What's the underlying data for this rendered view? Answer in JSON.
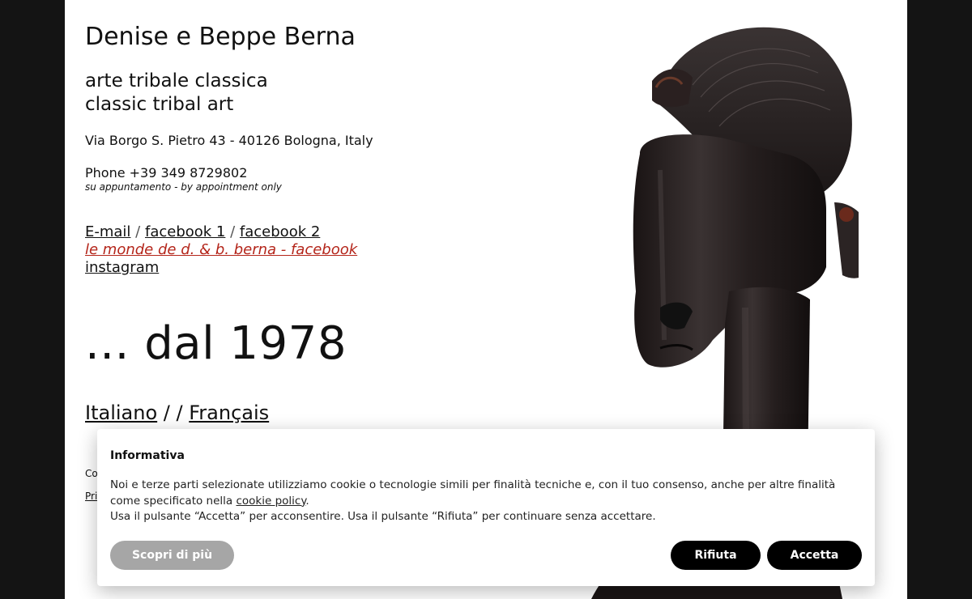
{
  "header": {
    "site_title": "Denise e Beppe Berna",
    "subtitle_it": "arte tribale classica",
    "subtitle_en": "classic tribal art"
  },
  "contact": {
    "address": "Via Borgo S. Pietro 43 - 40126 Bologna, Italy",
    "phone": "Phone +39 349 8729802",
    "appointment": "su appuntamento - by appointment only"
  },
  "links": {
    "email": "E-mail",
    "separator": "/",
    "facebook1": "facebook 1",
    "facebook2": "facebook 2",
    "monde": "le monde de d. & b. berna - facebook",
    "instagram": "instagram"
  },
  "since": "... dal 1978",
  "languages": {
    "italiano": "Italiano",
    "separator": "/ /",
    "francais": "Français"
  },
  "footer": {
    "copy_snippet": "Co",
    "privacy_snippet": "Priv"
  },
  "cookie": {
    "title": "Informativa",
    "text_before_link": "Noi e terze parti selezionate utilizziamo cookie o tecnologie simili per finalità tecniche e, con il tuo consenso, anche per altre finalità come specificato nella ",
    "link": "cookie policy",
    "text_after_link": ".",
    "text_line2": "Usa il pulsante “Accetta” per acconsentire. Usa il pulsante “Rifiuta” per continuare senza accettare.",
    "learn_more": "Scopri di più",
    "reject": "Rifiuta",
    "accept": "Accetta"
  },
  "colors": {
    "outer_background": "#141414",
    "page_background": "#ffffff",
    "link_red": "#b4251a",
    "learn_more_button": "#a6a6a6",
    "primary_button": "#000000"
  }
}
